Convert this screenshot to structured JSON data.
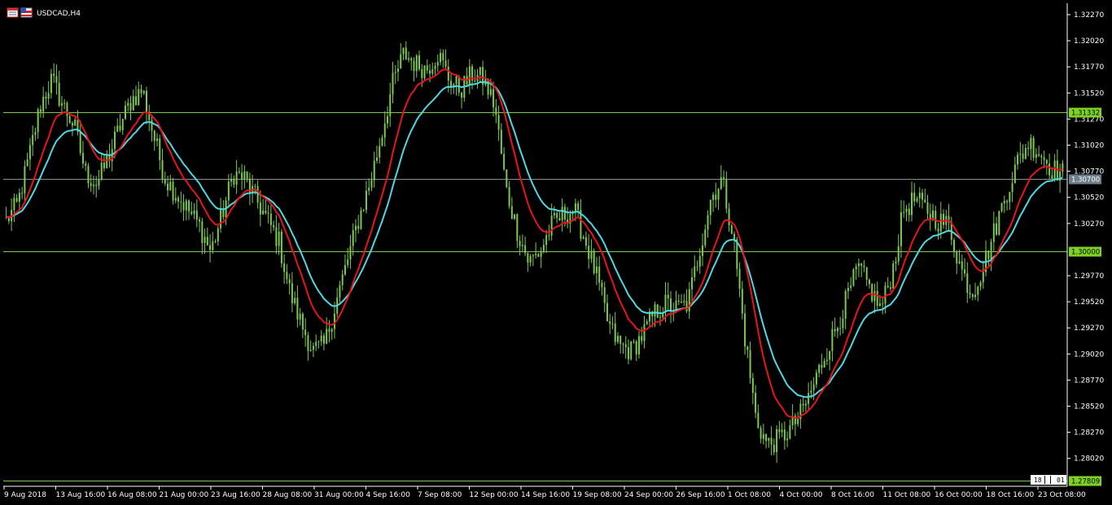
{
  "window": {
    "title": "USDCAD,H4"
  },
  "colors": {
    "background": "#000000",
    "candle": "#7ec850",
    "ma_fast": "#e8141b",
    "ma_slow": "#4fd8e4",
    "hline": "#7ec850",
    "current_price_line": "#8a8f96",
    "axis_text": "#ffffff",
    "hline_label_bg": "#7ed320",
    "current_label_bg": "#6f7e8a"
  },
  "chart_data": {
    "type": "candlestick",
    "symbol": "USDCAD",
    "timeframe": "H4",
    "title": "USDCAD,H4",
    "ylim": [
      1.278,
      1.3227
    ],
    "y_ticks": [
      "1.32270",
      "1.32020",
      "1.31770",
      "1.31520",
      "1.31270",
      "1.31020",
      "1.30770",
      "1.30520",
      "1.30270",
      "1.29770",
      "1.29520",
      "1.29270",
      "1.29020",
      "1.28770",
      "1.28520",
      "1.28270",
      "1.28020"
    ],
    "x_ticks": [
      "9 Aug 2018",
      "13 Aug 16:00",
      "16 Aug 08:00",
      "21 Aug 00:00",
      "23 Aug 16:00",
      "28 Aug 08:00",
      "31 Aug 00:00",
      "4 Sep 16:00",
      "7 Sep 08:00",
      "12 Sep 00:00",
      "14 Sep 16:00",
      "19 Sep 08:00",
      "24 Sep 00:00",
      "26 Sep 16:00",
      "1 Oct 08:00",
      "4 Oct 00:00",
      "8 Oct 16:00",
      "11 Oct 08:00",
      "16 Oct 00:00",
      "18 Oct 16:00",
      "23 Oct 08:00"
    ],
    "horizontal_lines": [
      {
        "label": "1.31332",
        "value": 1.31332
      },
      {
        "label": "1.30000",
        "value": 1.3
      },
      {
        "label": "1.27809",
        "value": 1.27809
      }
    ],
    "current_price": {
      "label": "1.30700",
      "value": 1.307
    },
    "price_path": [
      1.303,
      1.3045,
      1.309,
      1.314,
      1.3165,
      1.314,
      1.312,
      1.3075,
      1.3065,
      1.309,
      1.312,
      1.3145,
      1.3155,
      1.311,
      1.307,
      1.3055,
      1.304,
      1.3025,
      1.3,
      1.3035,
      1.3075,
      1.307,
      1.305,
      1.303,
      1.301,
      1.296,
      1.293,
      1.2905,
      1.291,
      1.295,
      1.299,
      1.303,
      1.3065,
      1.311,
      1.316,
      1.319,
      1.318,
      1.3175,
      1.319,
      1.3165,
      1.3155,
      1.317,
      1.3165,
      1.314,
      1.306,
      1.302,
      1.299,
      1.3,
      1.3025,
      1.3035,
      1.304,
      1.301,
      1.2975,
      1.293,
      1.291,
      1.2905,
      1.292,
      1.294,
      1.295,
      1.2945,
      1.295,
      1.3,
      1.305,
      1.307,
      1.3015,
      1.292,
      1.284,
      1.2815,
      1.282,
      1.283,
      1.2845,
      1.287,
      1.29,
      1.2925,
      1.2955,
      1.2985,
      1.2965,
      1.2945,
      1.298,
      1.304,
      1.305,
      1.304,
      1.303,
      1.3025,
      1.2985,
      1.296,
      1.2985,
      1.302,
      1.3055,
      1.3085,
      1.3105,
      1.3095,
      1.308,
      1.3075
    ],
    "series": [
      {
        "name": "",
        "role": "fast moving average",
        "color": "#e8141b"
      },
      {
        "name": "",
        "role": "slow moving average",
        "color": "#4fd8e4"
      }
    ]
  },
  "footer": {
    "counter_a": "18",
    "counter_b": "01"
  }
}
